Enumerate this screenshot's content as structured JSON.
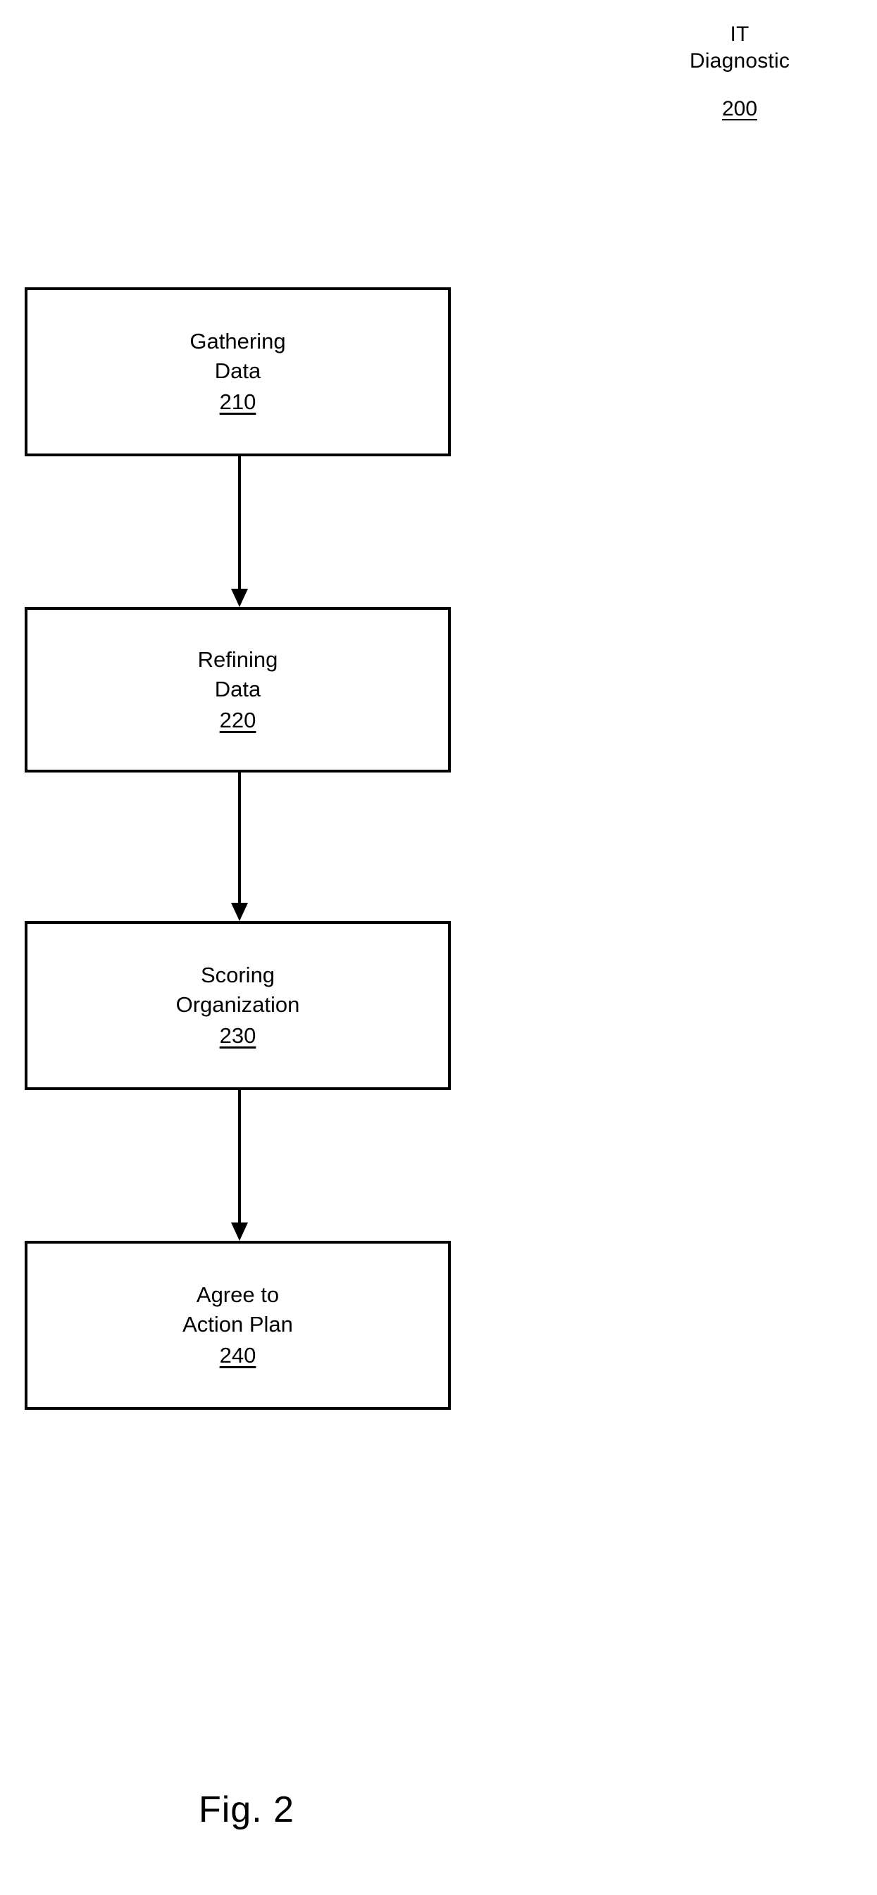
{
  "figure": {
    "header_lines": [
      "IT",
      "Diagnostic"
    ],
    "header_line_1": "IT",
    "header_line_2": "Diagnostic",
    "reference_numeral": "200",
    "caption": "Fig. 2"
  },
  "flowchart": {
    "orientation": "vertical",
    "nodes": [
      {
        "label_line_1": "Gathering",
        "label_line_2": "Data",
        "reference": "210"
      },
      {
        "label_line_1": "Refining",
        "label_line_2": "Data",
        "reference": "220"
      },
      {
        "label_line_1": "Scoring",
        "label_line_2": "Organization",
        "reference": "230"
      },
      {
        "label_line_1": "Agree to",
        "label_line_2": "Action Plan",
        "reference": "240"
      }
    ],
    "connectors": [
      {
        "from": "210",
        "to": "220",
        "arrow": "down"
      },
      {
        "from": "220",
        "to": "230",
        "arrow": "down"
      },
      {
        "from": "230",
        "to": "240",
        "arrow": "down"
      }
    ]
  },
  "colors": {
    "line": "#000000",
    "background": "#ffffff",
    "text": "#000000"
  }
}
